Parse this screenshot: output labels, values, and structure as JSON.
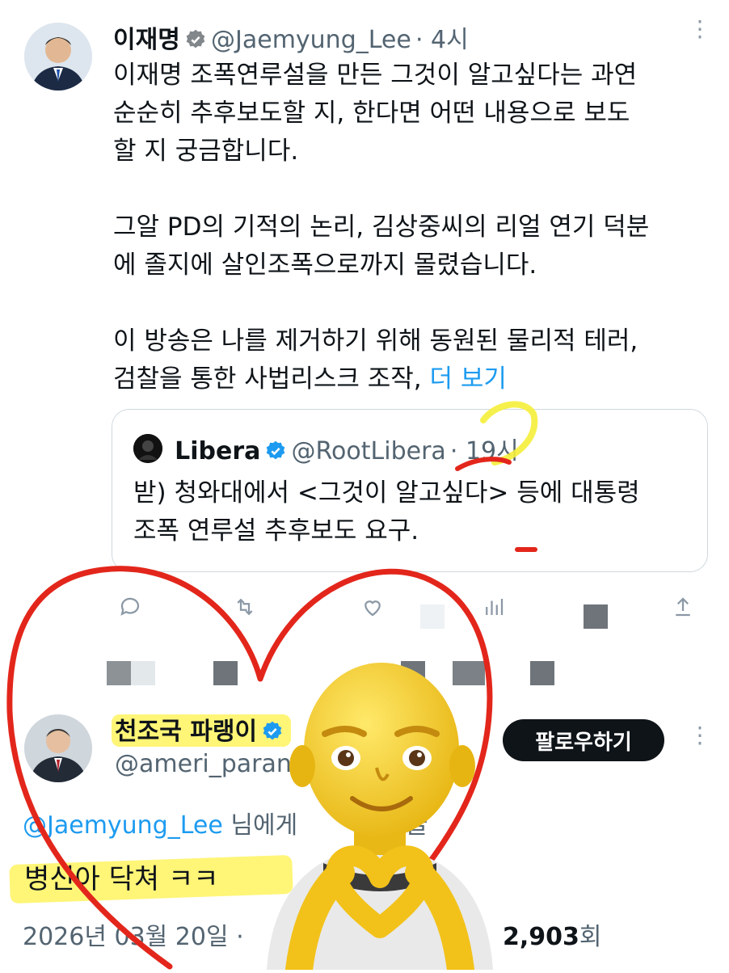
{
  "tweet": {
    "display_name": "이재명",
    "handle": "@Jaemyung_Lee",
    "time": "· 4시",
    "paragraphs": [
      [
        "이재명 조폭연루설을 만든 그것이 알고싶다는 과연",
        "순순히 추후보도할 지, 한다면 어떤 내용으로 보도",
        "할 지 궁금합니다."
      ],
      [
        "그알 PD의 기적의 논리, 김상중씨의 리얼 연기 덕분",
        "에 졸지에 살인조폭으로까지 몰렸습니다."
      ],
      [
        "이 방송은 나를 제거하기 위해 동원된 물리적 테러,",
        "검찰을 통한 사법리스크 조작,"
      ]
    ],
    "more_link": "더 보기"
  },
  "quote": {
    "display_name": "Libera",
    "handle": "@RootLibera",
    "time": "· 19시",
    "lines": [
      "받) 청와대에서 <그것이 알고싶다> 등에 대통령",
      "조폭 연루설 추후보도 요구."
    ]
  },
  "reply": {
    "display_name": "천조국 파랭이",
    "handle": "@ameri_paran",
    "follow_label": "팔로우하기",
    "reply_to_handle": "@Jaemyung_Lee",
    "reply_to_suffix": "님에게",
    "reply_to_end": "글",
    "text": "병신아 닥쳐 ㅋㅋ",
    "date": "2026년 03월 20일 ·",
    "views": "2,903",
    "views_unit": "회"
  },
  "colors": {
    "accent": "#1d9bf0",
    "heart_stroke": "#e3261b",
    "highlight": "#fff24a"
  },
  "icons": [
    "verified-badge-icon",
    "more-options-icon",
    "reply-icon",
    "retweet-icon",
    "like-icon",
    "share-icon",
    "emoji-heart-hands"
  ]
}
